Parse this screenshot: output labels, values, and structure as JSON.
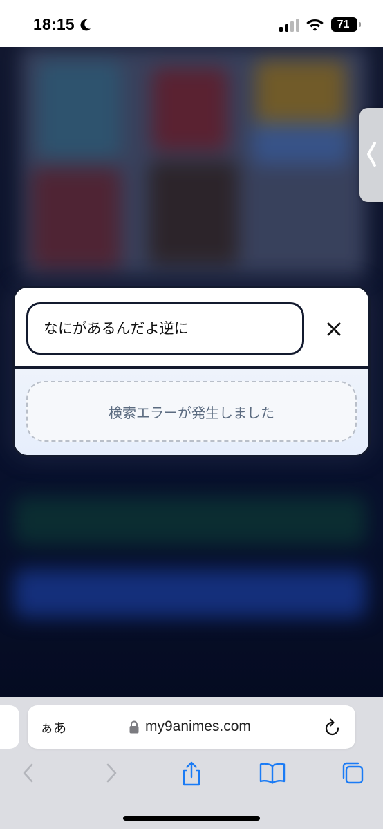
{
  "status_bar": {
    "time": "18:15",
    "battery": "71",
    "icons": [
      "moon-icon",
      "signal-icon",
      "wifi-icon",
      "battery-icon"
    ]
  },
  "search_modal": {
    "query_value": "なにがあるんだよ逆に",
    "close_icon": "close-icon",
    "error_message": "検索エラーが発生しました"
  },
  "side_tab": {
    "icon": "chevron-left-icon"
  },
  "browser": {
    "aa_label": "ぁあ",
    "url": "my9animes.com",
    "icons": [
      "lock-icon",
      "reload-icon",
      "back-icon",
      "forward-icon",
      "share-icon",
      "bookmarks-icon",
      "tabs-icon"
    ]
  },
  "colors": {
    "modal_border": "#131a2e",
    "error_text": "#5b6b80",
    "safari_blue": "#1a7bf5",
    "browser_bar_bg": "#dcdde2"
  }
}
